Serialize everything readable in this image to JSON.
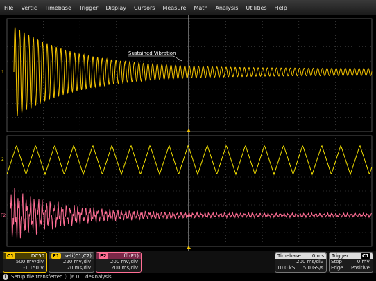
{
  "menu": [
    "File",
    "Vertic",
    "Timebase",
    "Trigger",
    "Display",
    "Cursors",
    "Measure",
    "Math",
    "Analysis",
    "Utilities",
    "Help"
  ],
  "plot": {
    "annotation": "Sustained Vibration",
    "channel_markers": {
      "c1": "1",
      "c2": "2",
      "f2": "F2"
    }
  },
  "colors": {
    "c1": "#f5c400",
    "c2": "#f5e200",
    "f2": "#ff6e94",
    "grid": "#555555",
    "cursor": "#c8c8c8"
  },
  "tiles": {
    "c1": {
      "badge": "C1",
      "title": "DC50",
      "line1": "500 mV/div",
      "line2": "-1.150 V"
    },
    "f1": {
      "badge": "F1",
      "title": "seti(C1,C2)",
      "line1": "220 mV/div",
      "line2": "20 ms/div"
    },
    "f2": {
      "badge": "F2",
      "title": "fft(F1)",
      "line1": "200 mV/div",
      "line2": "200 ms/div"
    },
    "timebase": {
      "title": "Timebase",
      "value": "0 ms",
      "line1": "200 ms/div",
      "line2a": "10.0 kS",
      "line2b": "5.0 GS/s"
    },
    "trigger": {
      "title": "Trigger",
      "badge": "C1",
      "line1a": "Stop",
      "line1b": "0 mV",
      "line2a": "Edge",
      "line2b": "Positive"
    }
  },
  "status": {
    "icon": "i",
    "text": "Setup file transferred (C)6.0 ...deAnalysis"
  }
}
